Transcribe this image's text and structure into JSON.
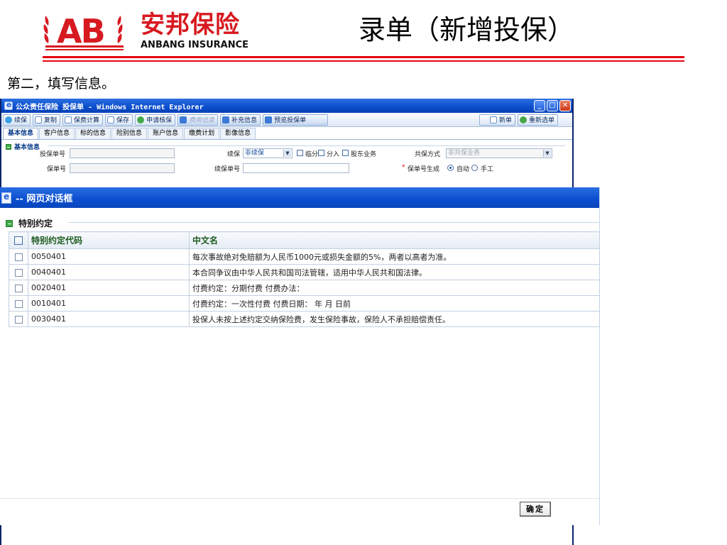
{
  "slide": {
    "logo_letters": "AB",
    "logo_cn": "安邦保险",
    "logo_en": "ANBANG INSURANCE",
    "title": "录单（新增投保）",
    "step_text": "第二，填写信息。",
    "brand_red": "#d71920"
  },
  "window": {
    "title": "公众责任保险 投保单 - Windows Internet Explorer",
    "minimize": "_",
    "maximize": "□",
    "close": "✕"
  },
  "toolbar": {
    "buttons": [
      "续保",
      "复制",
      "保费计算",
      "保存",
      "申请核保",
      "费用信息",
      "补充信息",
      "预览投保单"
    ],
    "right_buttons": [
      "新单",
      "重新选单"
    ]
  },
  "tabs": [
    "基本信息",
    "客户信息",
    "标的信息",
    "险别信息",
    "账户信息",
    "缴费计划",
    "影像信息"
  ],
  "basic_info": {
    "section_title": "基本信息",
    "policy_no_label": "投保单号",
    "renewal_label": "续保",
    "renewal_value": "非续保",
    "checkbox_temp": "临分",
    "checkbox_ri": "分入",
    "checkbox_shareholder": "股东业务",
    "coins_label": "共保方式",
    "coins_value": "非共保业务",
    "bao_no_label": "保单号",
    "renewal_no_label": "续保单号",
    "req_mark": "*",
    "gen_label": "保单号生成",
    "gen_auto": "自动",
    "gen_manual": "手工"
  },
  "dialog": {
    "title": "-- 网页对话框",
    "section_title": "特别约定",
    "columns": [
      "特别约定代码",
      "中文名"
    ],
    "rows": [
      {
        "code": "0050401",
        "name": "每次事故绝对免赔额为人民币1000元或损失金额的5%，两者以高者为准。"
      },
      {
        "code": "0040401",
        "name": "本合同争议由中华人民共和国司法管辖，适用中华人民共和国法律。"
      },
      {
        "code": "0020401",
        "name": "付费约定：分期付费 付费办法："
      },
      {
        "code": "0010401",
        "name": "付费约定：一次性付费 付费日期： 年 月 日前"
      },
      {
        "code": "0030401",
        "name": "投保人未按上述约定交纳保险费，发生保险事故，保险人不承担赔偿责任。"
      }
    ],
    "ok_label": "确定"
  }
}
